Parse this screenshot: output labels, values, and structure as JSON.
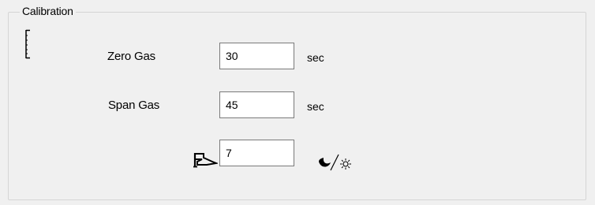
{
  "group": {
    "title": "Calibration"
  },
  "rows": {
    "zero": {
      "label": "Zero Gas",
      "value": "30",
      "unit": "sec"
    },
    "span": {
      "label": "Span Gas",
      "value": "45",
      "unit": "sec"
    },
    "third": {
      "value": "7",
      "icon": "flag-icon",
      "unit_icon": "moon-sun-icon"
    }
  },
  "icons": {
    "bracket": "bracket-icon"
  }
}
